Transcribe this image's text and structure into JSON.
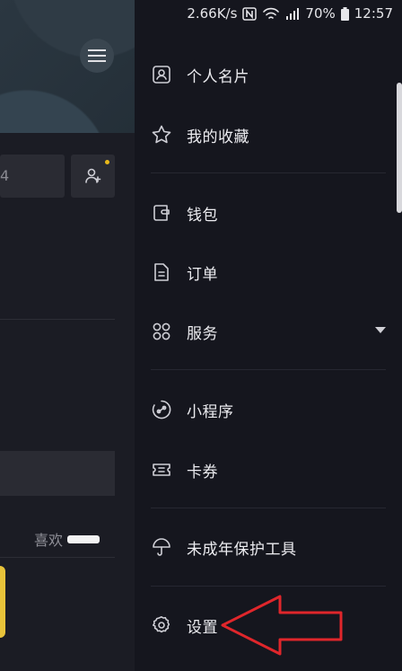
{
  "status_bar": {
    "speed": "2.66K/s",
    "battery": "70%",
    "time": "12:57"
  },
  "background": {
    "box_text": "4",
    "like_label": "喜欢"
  },
  "drawer": {
    "items": [
      {
        "label": "个人名片",
        "icon": "id-card-icon"
      },
      {
        "label": "我的收藏",
        "icon": "star-icon"
      },
      {
        "label": "钱包",
        "icon": "wallet-icon"
      },
      {
        "label": "订单",
        "icon": "order-icon"
      },
      {
        "label": "服务",
        "icon": "grid-icon"
      },
      {
        "label": "小程序",
        "icon": "mini-program-icon"
      },
      {
        "label": "卡券",
        "icon": "ticket-icon"
      },
      {
        "label": "未成年保护工具",
        "icon": "umbrella-icon"
      },
      {
        "label": "设置",
        "icon": "gear-icon"
      }
    ]
  },
  "colors": {
    "background": "#15161e",
    "annotation": "#e0262b",
    "notify_dot": "#e9b91a"
  }
}
